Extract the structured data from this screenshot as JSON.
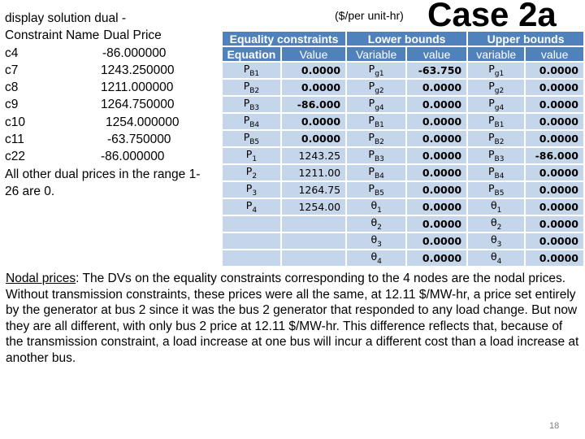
{
  "left_panel": {
    "title": "display solution dual -",
    "header_name": "Constraint Name",
    "header_value": "Dual Price",
    "rows": [
      {
        "name": "c4",
        "value": "-86.000000"
      },
      {
        "name": "c7",
        "value": "1243.250000"
      },
      {
        "name": "c8",
        "value": "1211.000000"
      },
      {
        "name": "c9",
        "value": "1264.750000"
      },
      {
        "name": "c10",
        "value": "1254.000000"
      },
      {
        "name": "c11",
        "value": "-63.750000"
      },
      {
        "name": "c22",
        "value": "-86.000000"
      }
    ],
    "footer_line1": "All other dual prices in the range 1-",
    "footer_line2": "26 are 0."
  },
  "header": {
    "units": "($/per unit-hr)",
    "case_title": "Case 2a"
  },
  "table": {
    "groups": {
      "equality": "Equality constraints",
      "lower": "Lower bounds",
      "upper": "Upper bounds"
    },
    "columns": {
      "eq_equation": "Equation",
      "eq_value": "Value",
      "lb_variable": "Variable",
      "lb_value": "value",
      "ub_variable": "variable",
      "ub_value": "value"
    },
    "rows": [
      {
        "eq_sym": "P",
        "eq_sub": "B1",
        "eq_val": "0.0000",
        "lb_sym": "P",
        "lb_sub": "g1",
        "lb_val": "-63.750",
        "ub_sym": "P",
        "ub_sub": "g1",
        "ub_val": "0.0000"
      },
      {
        "eq_sym": "P",
        "eq_sub": "B2",
        "eq_val": "0.0000",
        "lb_sym": "P",
        "lb_sub": "g2",
        "lb_val": "0.0000",
        "ub_sym": "P",
        "ub_sub": "g2",
        "ub_val": "0.0000"
      },
      {
        "eq_sym": "P",
        "eq_sub": "B3",
        "eq_val": "-86.000",
        "lb_sym": "P",
        "lb_sub": "g4",
        "lb_val": "0.0000",
        "ub_sym": "P",
        "ub_sub": "g4",
        "ub_val": "0.0000"
      },
      {
        "eq_sym": "P",
        "eq_sub": "B4",
        "eq_val": "0.0000",
        "lb_sym": "P",
        "lb_sub": "B1",
        "lb_val": "0.0000",
        "ub_sym": "P",
        "ub_sub": "B1",
        "ub_val": "0.0000"
      },
      {
        "eq_sym": "P",
        "eq_sub": "B5",
        "eq_val": "0.0000",
        "lb_sym": "P",
        "lb_sub": "B2",
        "lb_val": "0.0000",
        "ub_sym": "P",
        "ub_sub": "B2",
        "ub_val": "0.0000"
      },
      {
        "eq_sym": "P",
        "eq_sub": "1",
        "eq_val": "1243.25",
        "lb_sym": "P",
        "lb_sub": "B3",
        "lb_val": "0.0000",
        "ub_sym": "P",
        "ub_sub": "B3",
        "ub_val": "-86.000"
      },
      {
        "eq_sym": "P",
        "eq_sub": "2",
        "eq_val": "1211.00",
        "lb_sym": "P",
        "lb_sub": "B4",
        "lb_val": "0.0000",
        "ub_sym": "P",
        "ub_sub": "B4",
        "ub_val": "0.0000"
      },
      {
        "eq_sym": "P",
        "eq_sub": "3",
        "eq_val": "1264.75",
        "lb_sym": "P",
        "lb_sub": "B5",
        "lb_val": "0.0000",
        "ub_sym": "P",
        "ub_sub": "B5",
        "ub_val": "0.0000"
      },
      {
        "eq_sym": "P",
        "eq_sub": "4",
        "eq_val": "1254.00",
        "lb_sym": "θ",
        "lb_sub": "1",
        "lb_val": "0.0000",
        "ub_sym": "θ",
        "ub_sub": "1",
        "ub_val": "0.0000"
      },
      {
        "eq_sym": "",
        "eq_sub": "",
        "eq_val": "",
        "lb_sym": "θ",
        "lb_sub": "2",
        "lb_val": "0.0000",
        "ub_sym": "θ",
        "ub_sub": "2",
        "ub_val": "0.0000"
      },
      {
        "eq_sym": "",
        "eq_sub": "",
        "eq_val": "",
        "lb_sym": "θ",
        "lb_sub": "3",
        "lb_val": "0.0000",
        "ub_sym": "θ",
        "ub_sub": "3",
        "ub_val": "0.0000"
      },
      {
        "eq_sym": "",
        "eq_sub": "",
        "eq_val": "",
        "lb_sym": "θ",
        "lb_sub": "4",
        "lb_val": "0.0000",
        "ub_sym": "θ",
        "ub_sub": "4",
        "ub_val": "0.0000"
      }
    ]
  },
  "paragraph": {
    "lead": "Nodal prices",
    "body": ": The DVs on the equality constraints corresponding to the 4 nodes are the nodal prices. Without transmission constraints, these prices were all the same, at 12.11 $/MW-hr, a price set entirely by the generator at bus 2 since it was the bus 2 generator that responded to any load change. But now they are all different, with only bus 2 price at 12.11 $/MW-hr. This difference reflects that, because of the transmission constraint, a load increase at one bus will incur a different cost than a load increase at another bus."
  },
  "page_number": "18",
  "colors": {
    "header_fill": "#4f81bd",
    "cell_fill": "#c5d5ea",
    "header_text": "#ffffff"
  }
}
